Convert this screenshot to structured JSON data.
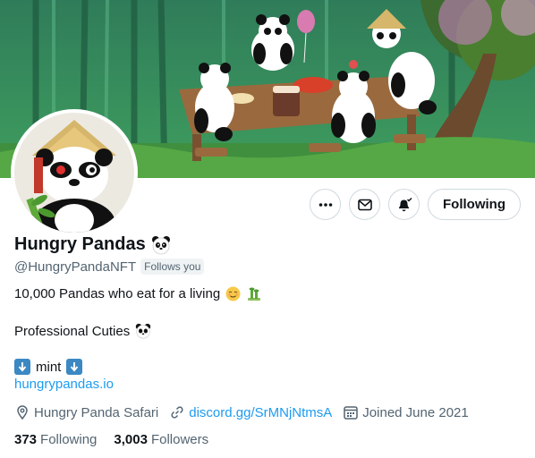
{
  "profile": {
    "display_name": "Hungry Pandas",
    "handle": "@HungryPandaNFT",
    "follows_you_badge": "Follows you",
    "bio_line1": "10,000 Pandas who eat for a living",
    "bio_line2": "Professional Cuties",
    "mint_label": "mint",
    "website": "hungrypandas.io",
    "location": "Hungry Panda Safari",
    "discord_link": "discord.gg/SrMNjNtmsA",
    "joined": "Joined June 2021"
  },
  "stats": {
    "following_count": "373",
    "following_label": "Following",
    "followers_count": "3,003",
    "followers_label": "Followers"
  },
  "actions": {
    "more_icon": "more-icon",
    "message_icon": "envelope-icon",
    "notifications_icon": "bell-check-icon",
    "follow_label": "Following"
  },
  "colors": {
    "link": "#1d9bf0",
    "secondary_text": "#536471",
    "primary_text": "#0f1419",
    "border": "#cfd9de"
  }
}
